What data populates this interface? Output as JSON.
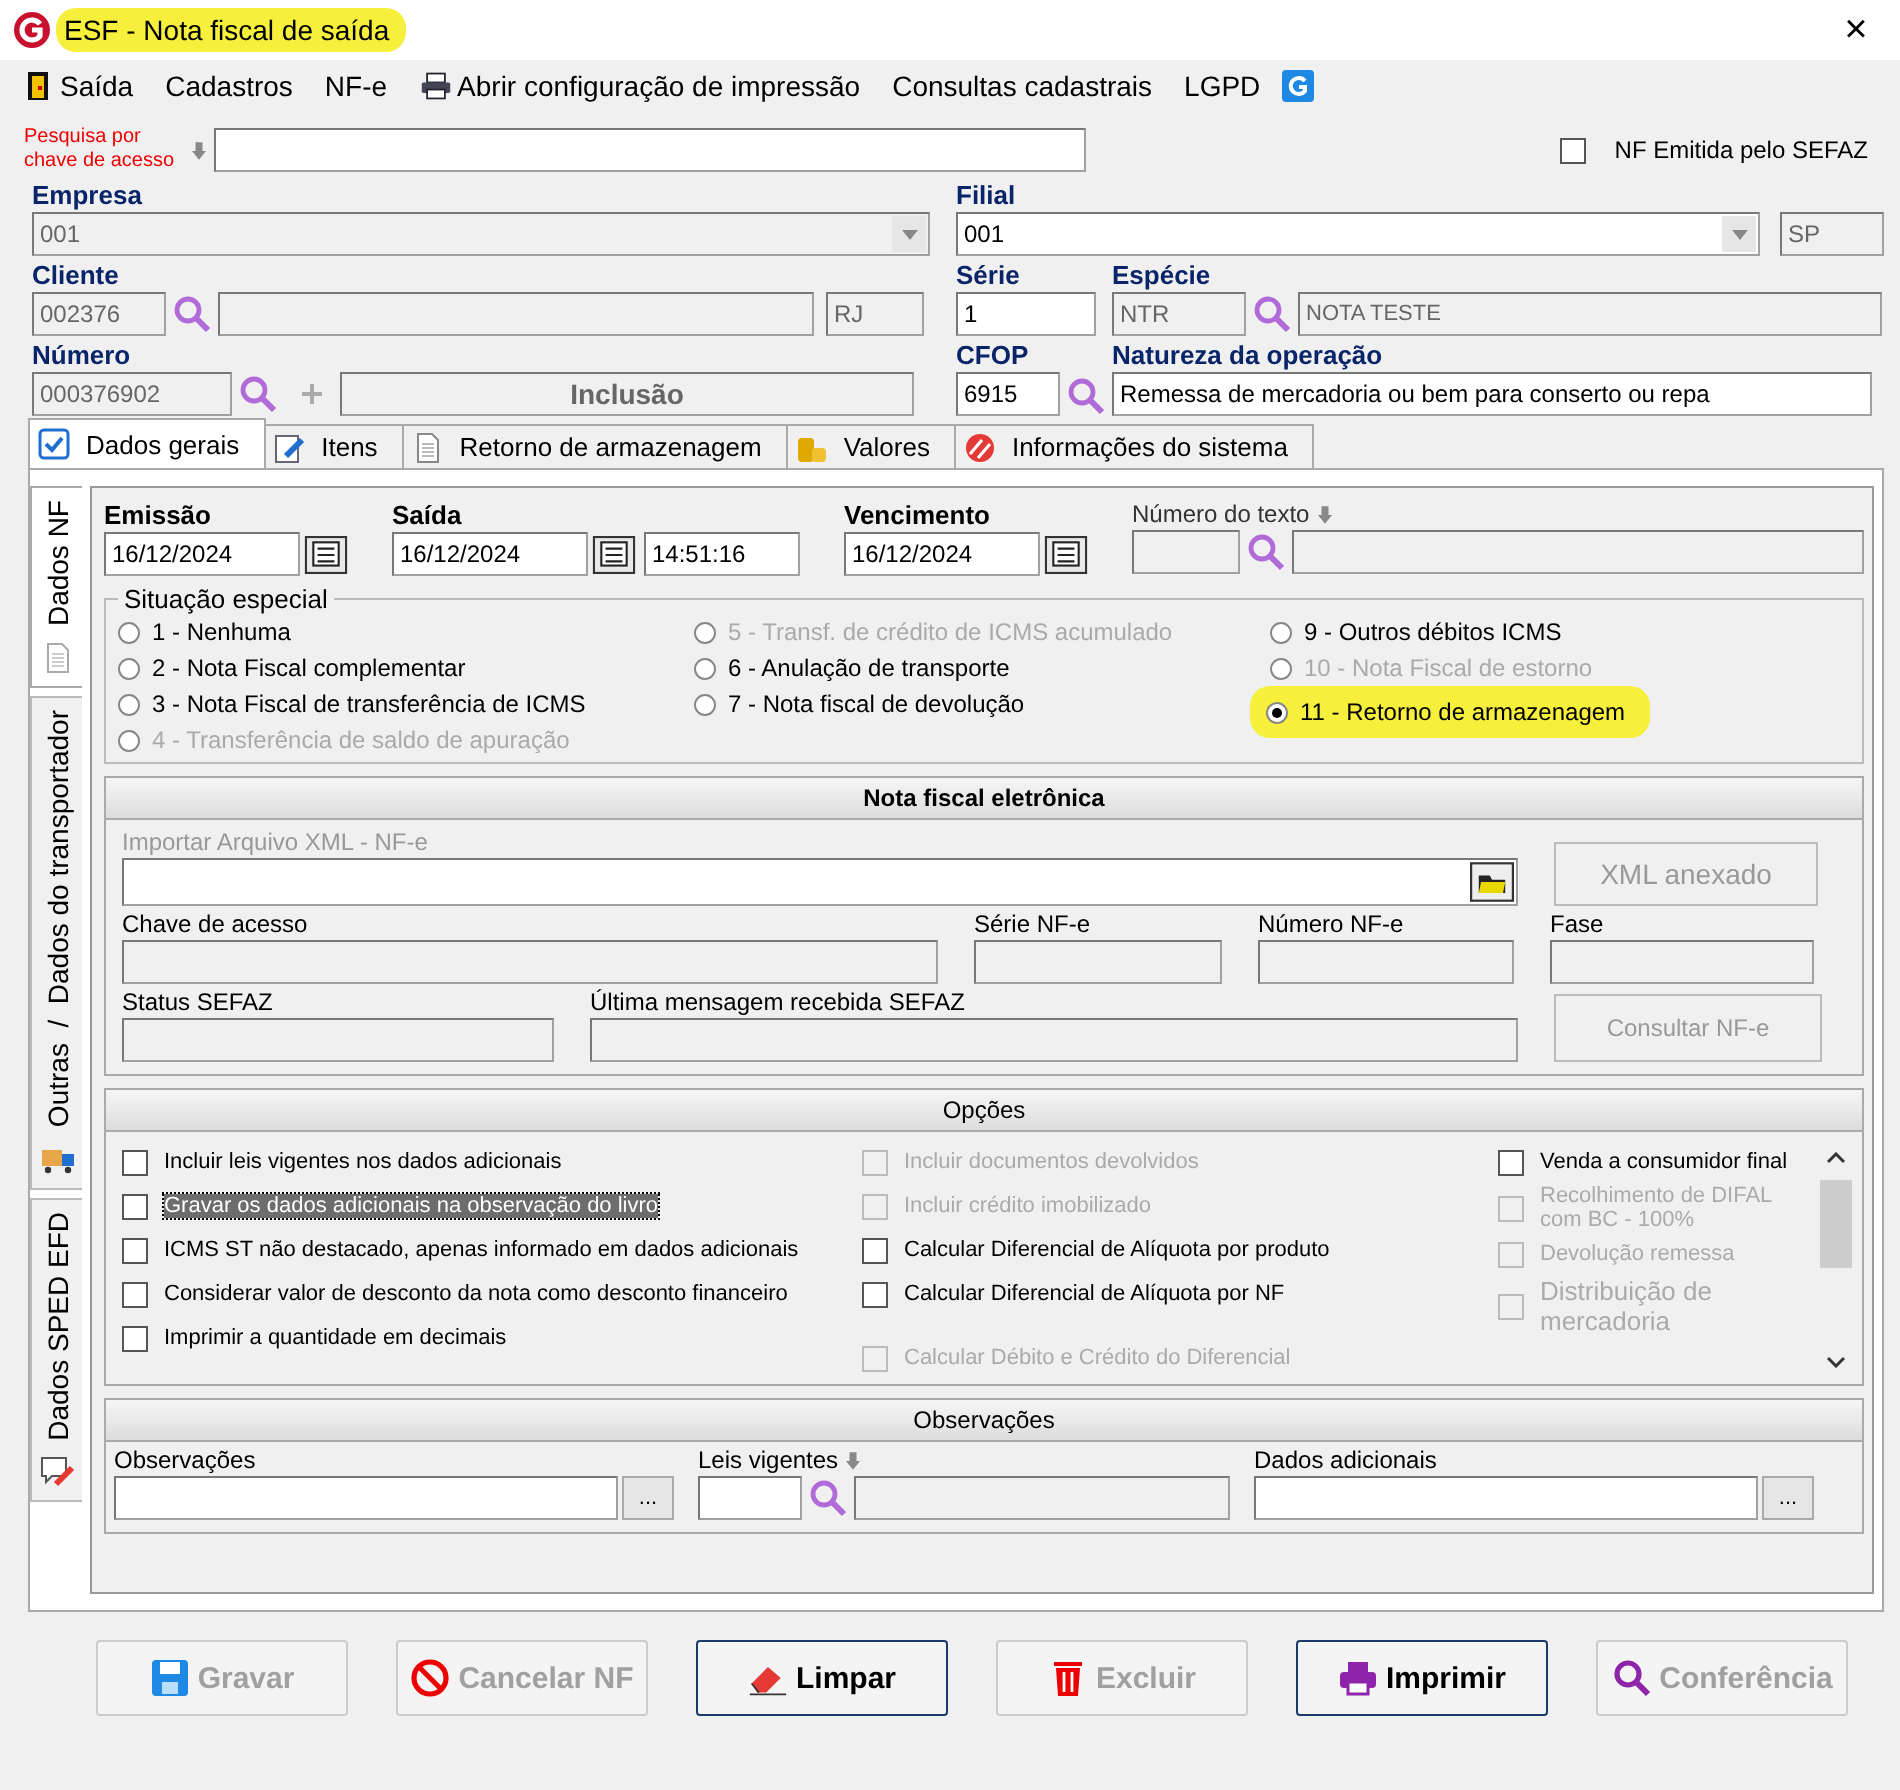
{
  "window": {
    "title": "ESF - Nota fiscal de saída",
    "highlighted": true,
    "close": "×"
  },
  "menu": [
    {
      "label": "Saída",
      "kind": "exit"
    },
    {
      "label": "Cadastros"
    },
    {
      "label": "NF-e"
    },
    {
      "label": "Abrir configuração de impressão",
      "kind": "printer"
    },
    {
      "label": "Consultas cadastrais"
    },
    {
      "label": "LGPD"
    }
  ],
  "search": {
    "label": "Pesquisa por chave de acesso"
  },
  "nf_emitida": {
    "label": "NF Emitida pelo SEFAZ",
    "checked": false
  },
  "header": {
    "empresa": {
      "label": "Empresa",
      "value": "001"
    },
    "filial": {
      "label": "Filial",
      "value": "001",
      "uf": "SP"
    },
    "cliente": {
      "label": "Cliente",
      "value": "002376",
      "uf": "RJ"
    },
    "serie": {
      "label": "Série",
      "value": "1"
    },
    "especie": {
      "label": "Espécie",
      "value": "NTR",
      "description": "NOTA TESTE"
    },
    "numero": {
      "label": "Número",
      "value": "000376902",
      "status": "Inclusão"
    },
    "cfop": {
      "label": "CFOP",
      "value": "6915"
    },
    "natureza": {
      "label": "Natureza da operação",
      "value": "Remessa de mercadoria ou bem para conserto ou repa"
    }
  },
  "tabs": [
    {
      "label": "Dados gerais",
      "kind": "check",
      "selected": true
    },
    {
      "label": "Itens",
      "kind": "edit",
      "selected": false
    },
    {
      "label": "Retorno de armazenagem",
      "kind": "doc",
      "selected": false
    },
    {
      "label": "Valores",
      "kind": "coins",
      "selected": false
    },
    {
      "label": "Informações do sistema",
      "kind": "stripes",
      "selected": false
    }
  ],
  "side_tabs": [
    {
      "label": "Dados NF",
      "kind": "doc",
      "selected": true
    },
    {
      "label": "Outras  /  Dados do transportador",
      "kind": "truck",
      "selected": false
    },
    {
      "label": "Dados SPED EFD",
      "kind": "note",
      "selected": false
    }
  ],
  "dates": {
    "emissao": {
      "label": "Emissão",
      "value": "16/12/2024"
    },
    "saida": {
      "label": "Saída",
      "value": "16/12/2024",
      "time": "14:51:16"
    },
    "vencimento": {
      "label": "Vencimento",
      "value": "16/12/2024"
    },
    "numero_texto": {
      "label": "Número do texto"
    }
  },
  "situacao": {
    "title": "Situação especial",
    "columns": [
      [
        {
          "label": "1 - Nenhuma",
          "selected": false,
          "disabled": false,
          "highlighted": false
        },
        {
          "label": "2 - Nota Fiscal complementar",
          "selected": false,
          "disabled": false,
          "highlighted": false
        },
        {
          "label": "3 - Nota Fiscal de transferência de ICMS",
          "selected": false,
          "disabled": false,
          "highlighted": false
        },
        {
          "label": "4 - Transferência de saldo de apuração",
          "selected": false,
          "disabled": true,
          "highlighted": false
        }
      ],
      [
        {
          "label": "5 - Transf. de crédito de ICMS acumulado",
          "selected": false,
          "disabled": true,
          "highlighted": false
        },
        {
          "label": "6 - Anulação de transporte",
          "selected": false,
          "disabled": false,
          "highlighted": false
        },
        {
          "label": "7 - Nota fiscal de devolução",
          "selected": false,
          "disabled": false,
          "highlighted": false
        }
      ],
      [
        {
          "label": "9 - Outros débitos ICMS",
          "selected": false,
          "disabled": false,
          "highlighted": false
        },
        {
          "label": "10 - Nota Fiscal de estorno",
          "selected": false,
          "disabled": true,
          "highlighted": false
        },
        {
          "label": "11 - Retorno de armazenagem",
          "selected": true,
          "disabled": false,
          "highlighted": true
        }
      ]
    ]
  },
  "nfe": {
    "title": "Nota fiscal eletrônica",
    "import_label": "Importar Arquivo XML - NF-e",
    "xml_button": "XML anexado",
    "chave": "Chave de acesso",
    "serie": "Série NF-e",
    "numero": "Número NF-e",
    "fase": "Fase",
    "status": "Status SEFAZ",
    "mensagem": "Última mensagem recebida SEFAZ",
    "consultar_button": "Consultar NF-e"
  },
  "opcoes": {
    "title": "Opções",
    "columns": [
      [
        {
          "label": "Incluir leis vigentes nos dados adicionais",
          "checked": false,
          "disabled": false,
          "focused": false
        },
        {
          "label": "Gravar os dados adicionais na observação do livro",
          "checked": false,
          "disabled": false,
          "focused": true
        },
        {
          "label": "ICMS ST  não destacado, apenas informado em dados adicionais",
          "checked": false,
          "disabled": false,
          "focused": false
        },
        {
          "label": "Considerar valor de desconto da nota como desconto financeiro",
          "checked": false,
          "disabled": false,
          "focused": false
        },
        {
          "label": "Imprimir a quantidade em decimais",
          "checked": false,
          "disabled": false,
          "focused": false
        }
      ],
      [
        {
          "label": "Incluir documentos devolvidos",
          "checked": false,
          "disabled": true,
          "focused": false
        },
        {
          "label": "Incluir crédito imobilizado",
          "checked": false,
          "disabled": true,
          "focused": false
        },
        {
          "label": "Calcular Diferencial de Alíquota por produto",
          "checked": false,
          "disabled": false,
          "focused": false
        },
        {
          "label": "Calcular Diferencial de Alíquota por NF",
          "checked": false,
          "disabled": false,
          "focused": false
        },
        {
          "label": "Calcular Débito e Crédito do Diferencial",
          "checked": false,
          "disabled": true,
          "focused": false
        }
      ],
      [
        {
          "label": "Venda a consumidor final",
          "checked": false,
          "disabled": false,
          "focused": false
        },
        {
          "label": "Recolhimento de DIFAL com BC - 100%",
          "checked": false,
          "disabled": true,
          "focused": false
        },
        {
          "label": "Devolução remessa",
          "checked": false,
          "disabled": true,
          "focused": false
        },
        {
          "label": "Distribuição de mercadoria",
          "checked": false,
          "disabled": true,
          "focused": false
        }
      ]
    ]
  },
  "observacoes": {
    "title": "Observações",
    "observacoes": "Observações",
    "leis": "Leis vigentes",
    "dados": "Dados adicionais",
    "more": "..."
  },
  "buttons": [
    {
      "label": "Gravar",
      "kind": "save",
      "disabled": true
    },
    {
      "label": "Cancelar NF",
      "kind": "cancel",
      "disabled": true
    },
    {
      "label": "Limpar",
      "kind": "eraser",
      "disabled": false
    },
    {
      "label": "Excluir",
      "kind": "trash",
      "disabled": true
    },
    {
      "label": "Imprimir",
      "kind": "printer",
      "disabled": false
    },
    {
      "label": "Conferência",
      "kind": "search",
      "disabled": true
    }
  ]
}
